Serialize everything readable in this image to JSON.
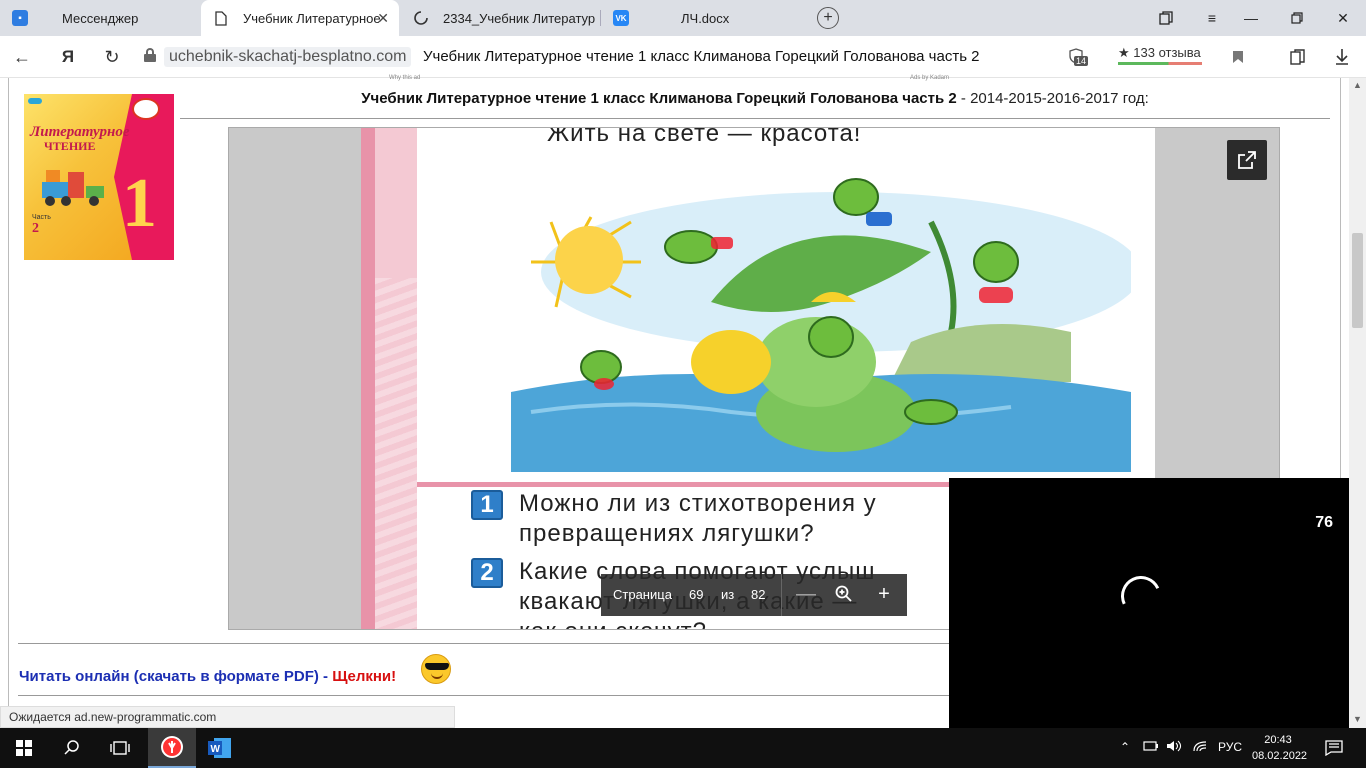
{
  "tabs": [
    {
      "label": "Мессенджер",
      "icon": "messenger-icon",
      "active": false
    },
    {
      "label": "Учебник Литературное",
      "icon": "document-icon",
      "active": true
    },
    {
      "label": "2334_Учебник Литератур",
      "icon": "loading-icon",
      "active": false
    },
    {
      "label": "ЛЧ.docx",
      "icon": "vk-icon",
      "active": false
    }
  ],
  "address": {
    "domain": "uchebnik-skachatj-besplatno.com",
    "page_title": "Учебник Литературное чтение 1 класс Климанова Горецкий Голованова часть 2",
    "reviews": "★ 133 отзыва",
    "protect_badge": "14"
  },
  "page": {
    "top_note_left": "Why this ad",
    "top_note_right": "Ads by Kadam",
    "heading_bold": "Учебник Литературное чтение 1 класс Климанова Горецкий Голованова часть 2",
    "heading_rest": " - 2014-2015-2016-2017 год:",
    "cover": {
      "title1": "Литературное",
      "title2": "ЧТЕНИЕ",
      "number": "1",
      "part_label": "Часть",
      "part_number": "2"
    },
    "book": {
      "headline": "Жить на свете — красота!",
      "q1_num": "1",
      "q1_line1": "Можно ли из стихотворения у",
      "q1_line2": "превращениях лягушки?",
      "q2_num": "2",
      "q2_line1": "Какие слова помогают услыш",
      "q2_line2": "квакают лягушки, а какие —",
      "q2_line3": "как они скачут?"
    },
    "pdf_toolbar": {
      "page_label": "Страница",
      "current_page": "69",
      "of_label": "из",
      "total_pages": "82",
      "zoom_out": "—",
      "zoom_in": "+"
    },
    "read_link": "Читать онлайн (скачать в формате PDF) - ",
    "read_link_click": "Щелкни!",
    "status_text": "Ожидается ad.new-programmatic.com"
  },
  "overlay": {
    "counter": "76"
  },
  "taskbar": {
    "language": "РУС",
    "time": "20:43",
    "date": "08.02.2022"
  },
  "colors": {
    "link_blue": "#1c2fb3",
    "click_red": "#d71010",
    "question_badge": "#2f7fc9"
  }
}
